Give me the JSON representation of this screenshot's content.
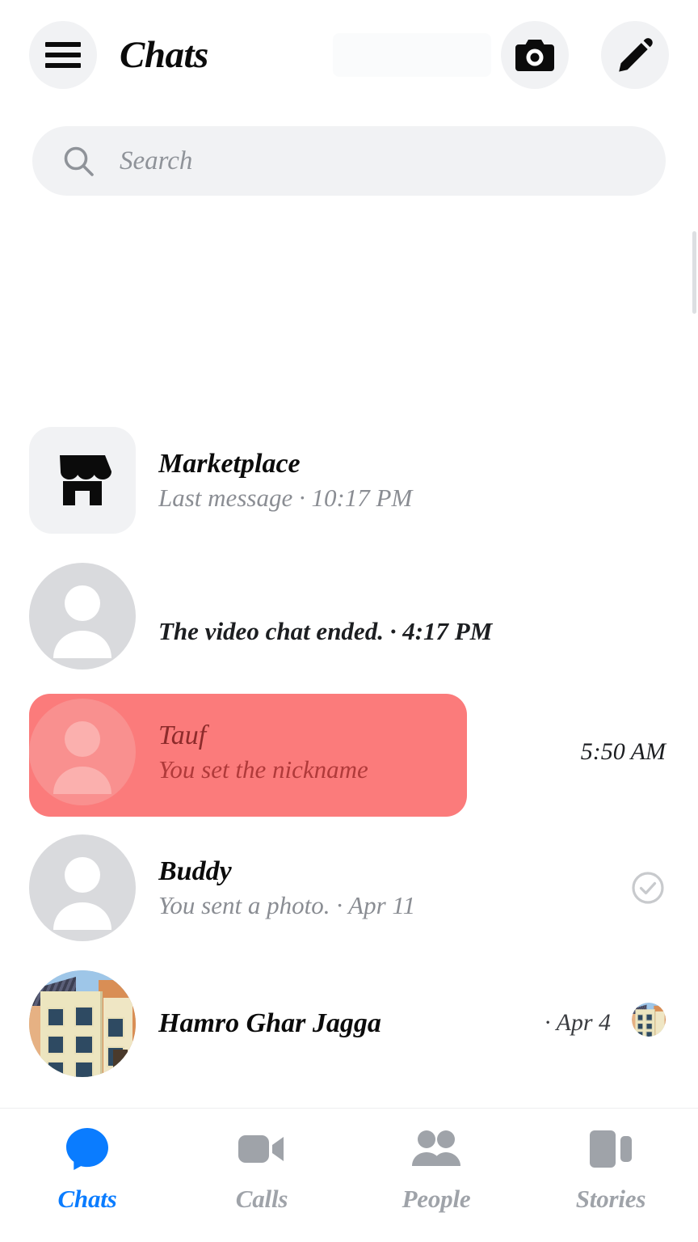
{
  "header": {
    "menu_icon": "hamburger-menu-icon",
    "title": "Chats",
    "camera_icon": "camera-icon",
    "compose_icon": "pencil-compose-icon"
  },
  "search": {
    "icon": "search-icon",
    "placeholder": "Search",
    "value": ""
  },
  "chats": [
    {
      "name": "Marketplace",
      "preview": "Last message · 10:17 PM",
      "avatar_type": "marketplace-icon",
      "time": "",
      "receipt": "none",
      "unread": false,
      "selected": false
    },
    {
      "name": "",
      "preview": "The video chat ended. · 4:17 PM",
      "avatar_type": "person-placeholder",
      "time": "",
      "receipt": "none",
      "unread": true,
      "selected": false
    },
    {
      "name": "Tauf",
      "preview": "You set the nickname",
      "avatar_type": "person-placeholder",
      "time": "5:50 AM",
      "receipt": "none",
      "unread": false,
      "selected": true
    },
    {
      "name": "Buddy",
      "preview": "You sent a photo. · Apr 11",
      "avatar_type": "person-placeholder",
      "time": "",
      "receipt": "check-circle-icon",
      "unread": false,
      "selected": false
    },
    {
      "name": "Hamro Ghar Jagga",
      "preview": "· Apr 4",
      "avatar_type": "building-photo",
      "time": "",
      "receipt": "avatar-thumb",
      "unread": false,
      "selected": false
    }
  ],
  "bottom_nav": [
    {
      "label": "Chats",
      "icon": "chat-bubble-icon",
      "active": true
    },
    {
      "label": "Calls",
      "icon": "video-camera-icon",
      "active": false
    },
    {
      "label": "People",
      "icon": "people-icon",
      "active": false
    },
    {
      "label": "Stories",
      "icon": "stories-icon",
      "active": false
    }
  ],
  "colors": {
    "accent_blue": "#0a7cff",
    "selection_pink": "#fb7b7b",
    "inactive_gray": "#9fa3a9",
    "chip_gray": "#f1f2f4"
  }
}
